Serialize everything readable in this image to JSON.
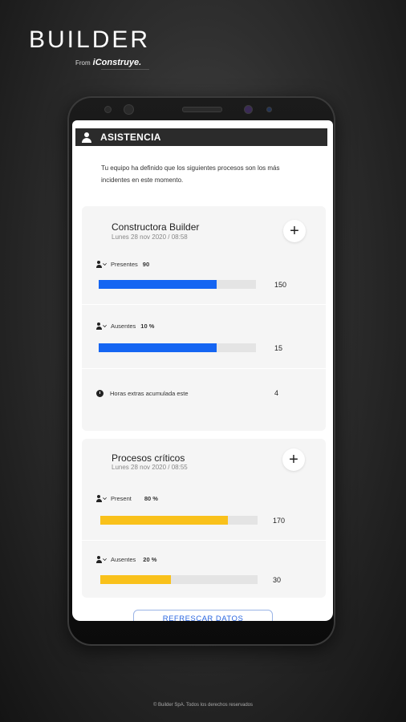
{
  "brand": {
    "title": "BUILDER",
    "from": "From",
    "logo": "iConstruye."
  },
  "header": {
    "title": "ASISTENCIA"
  },
  "intro": "Tu equipo ha definido que los siguientes procesos son los más incidentes en este momento.",
  "cards": [
    {
      "title": "Constructora Builder",
      "date": "Lunes 28 nov 2020 / 08:58",
      "rows": [
        {
          "label": "Presentes",
          "pct": "90",
          "value": "150",
          "fill": 0.75
        },
        {
          "label": "Ausentes",
          "pct": "10 %",
          "value": "15",
          "fill": 0.75
        },
        {
          "label": "Horas extras acumulada este",
          "value": "4"
        }
      ],
      "color": "#1565f2"
    },
    {
      "title": "Procesos críticos",
      "date": "Lunes 28 nov 2020 / 08:55",
      "rows": [
        {
          "label": "Present",
          "pct": "80 %",
          "value": "170",
          "fill": 0.81
        },
        {
          "label": "Ausentes",
          "pct": "20 %",
          "value": "30",
          "fill": 0.45
        }
      ],
      "color": "#f9c11b"
    }
  ],
  "refresh_label": "REFRESCAR DATOS",
  "footer": "© Builder SpA. Todos los derechos reservados"
}
